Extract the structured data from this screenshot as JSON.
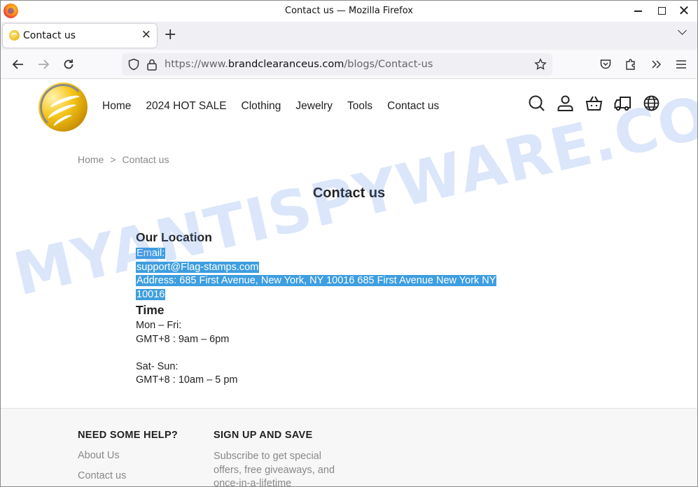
{
  "window": {
    "title": "Contact us — Mozilla Firefox"
  },
  "tab": {
    "label": "Contact us"
  },
  "urlbar": {
    "prefix": "https://www.",
    "domain": "brandclearanceus.com",
    "path": "/blogs/Contact-us"
  },
  "site": {
    "nav": [
      "Home",
      "2024 HOT SALE",
      "Clothing",
      "Jewelry",
      "Tools",
      "Contact us"
    ],
    "header_icons": [
      "search-icon",
      "account-icon",
      "cart-icon",
      "shipping-truck-icon",
      "globe-icon"
    ]
  },
  "breadcrumb": {
    "home": "Home",
    "sep": ">",
    "current": "Contact us"
  },
  "page": {
    "title": "Contact us",
    "location_heading": "Our Location",
    "email_label": "Email:",
    "email": "support@Flag-stamps.com",
    "address_line1": "Address:  685 First Avenue, New York, NY 10016 685 First Avenue New York NY",
    "address_line2": "10016",
    "time_heading": "Time",
    "weekday_label": "Mon – Fri:",
    "weekday_hours": "GMT+8 : 9am – 6pm",
    "weekend_label": "Sat- Sun:",
    "weekend_hours": "GMT+8 : 10am – 5 pm"
  },
  "watermark": "MYANTISPYWARE.COM",
  "footer": {
    "help_heading": "NEED SOME HELP?",
    "help_links": [
      "About Us",
      "Contact us"
    ],
    "signup_heading": "SIGN UP AND SAVE",
    "signup_text": "Subscribe to get special offers, free giveaways, and once-in-a-lifetime"
  }
}
